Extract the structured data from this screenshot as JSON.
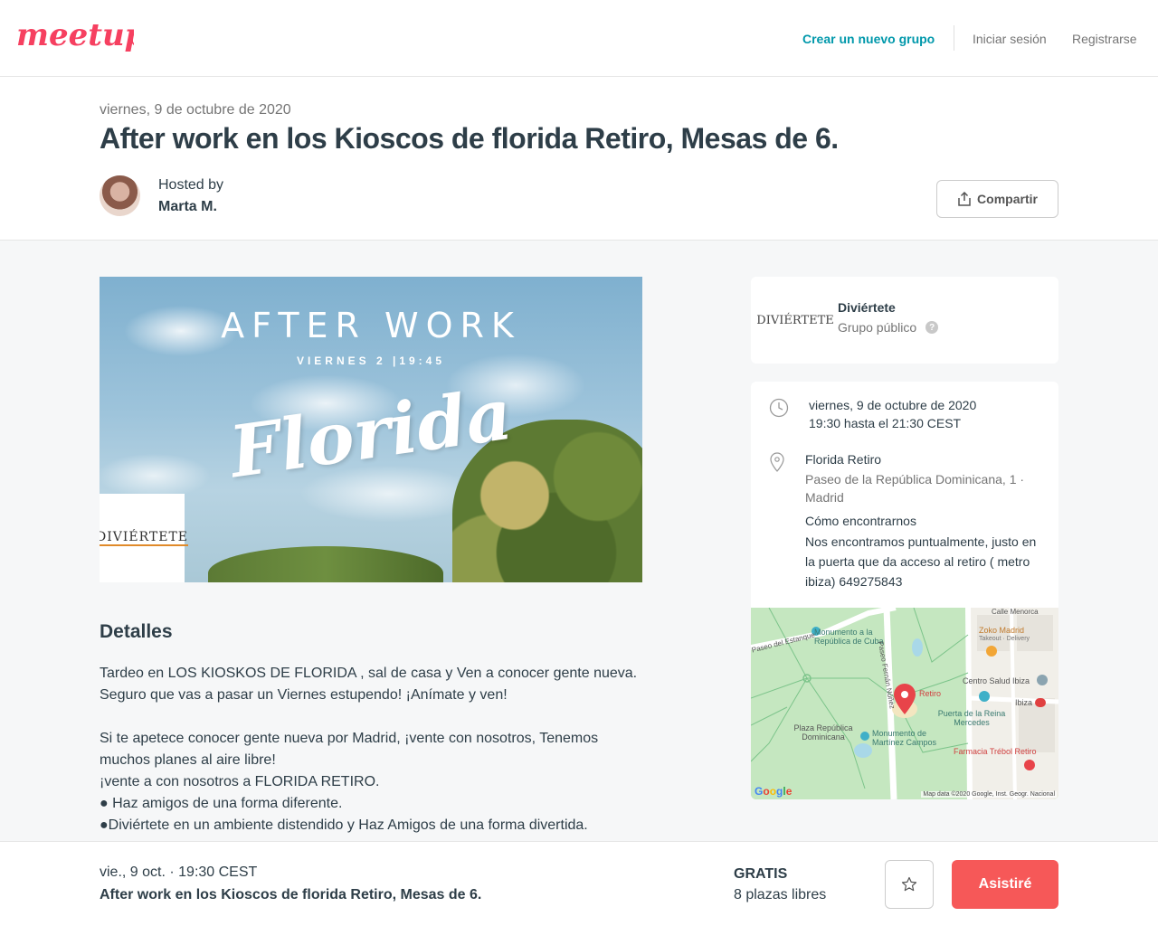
{
  "nav": {
    "logo_text": "meetup",
    "create_group": "Crear un nuevo grupo",
    "login": "Iniciar sesión",
    "register": "Registrarse"
  },
  "event": {
    "date": "viernes, 9 de octubre de 2020",
    "title": "After work en los Kioscos de florida Retiro, Mesas de 6.",
    "hosted_by_label": "Hosted by",
    "host_name": "Marta M.",
    "share_label": "Compartir"
  },
  "hero": {
    "line1": "AFTER WORK",
    "line2": "VIERNES 2 |19:45",
    "script": "Florida",
    "badge": "DIVIÉRTETE"
  },
  "details": {
    "title": "Detalles",
    "paragraphs": [
      "Tardeo en LOS KIOSKOS DE FLORIDA , sal de casa y Ven a conocer gente nueva. Seguro que vas a pasar un Viernes estupendo! ¡Anímate y ven!",
      "",
      "Si te apetece conocer gente nueva por Madrid, ¡vente con nosotros, Tenemos muchos planes al aire libre!",
      "¡vente a con nosotros a FLORIDA RETIRO.",
      "● Haz amigos de una forma diferente.",
      "●Diviértete en un ambiente distendido y Haz Amigos de una forma divertida."
    ]
  },
  "group": {
    "logo_text": "DIVIÉRTETE",
    "name": "Diviértete",
    "type": "Grupo público",
    "help": "?"
  },
  "info": {
    "date": "viernes, 9 de octubre de 2020",
    "time": "19:30 hasta el 21:30 CEST",
    "venue_name": "Florida Retiro",
    "venue_address": "Paseo de la República Dominicana, 1 · Madrid",
    "how_title": "Cómo encontrarnos",
    "how_text": "Nos encontramos puntualmente, justo en la puerta que da acceso al retiro ( metro ibiza) 649275843"
  },
  "map": {
    "labels": {
      "calle_menorca": "Calle Menorca",
      "monumento_cuba": "Monumento a la República de Cuba",
      "paseo_estanque": "Paseo del Estanque",
      "paseo_fernan": "Paseo Fernán Núñez",
      "zoko": "Zoko Madrid",
      "zoko_sub": "Takeout · Delivery",
      "centro_salud": "Centro Salud Ibiza",
      "retiro": "Retiro",
      "ibiza": "Ibiza",
      "puerta": "Puerta de la Reina Mercedes",
      "plaza": "Plaza República Dominicana",
      "monumento_martinez": "Monumento de Martínez Campos",
      "farmacia": "Farmacia Trébol Retiro"
    },
    "google": "Google",
    "attribution": "Map data ©2020 Google, Inst. Geogr. Nacional"
  },
  "footer": {
    "date": "vie., 9 oct. · 19:30 CEST",
    "title": "After work en los Kioscos de florida Retiro, Mesas de 6.",
    "price": "GRATIS",
    "spots": "8 plazas libres",
    "attend_label": "Asistiré"
  },
  "colors": {
    "brand": "#f64060",
    "teal": "#0098ab",
    "attend": "#f65858"
  }
}
